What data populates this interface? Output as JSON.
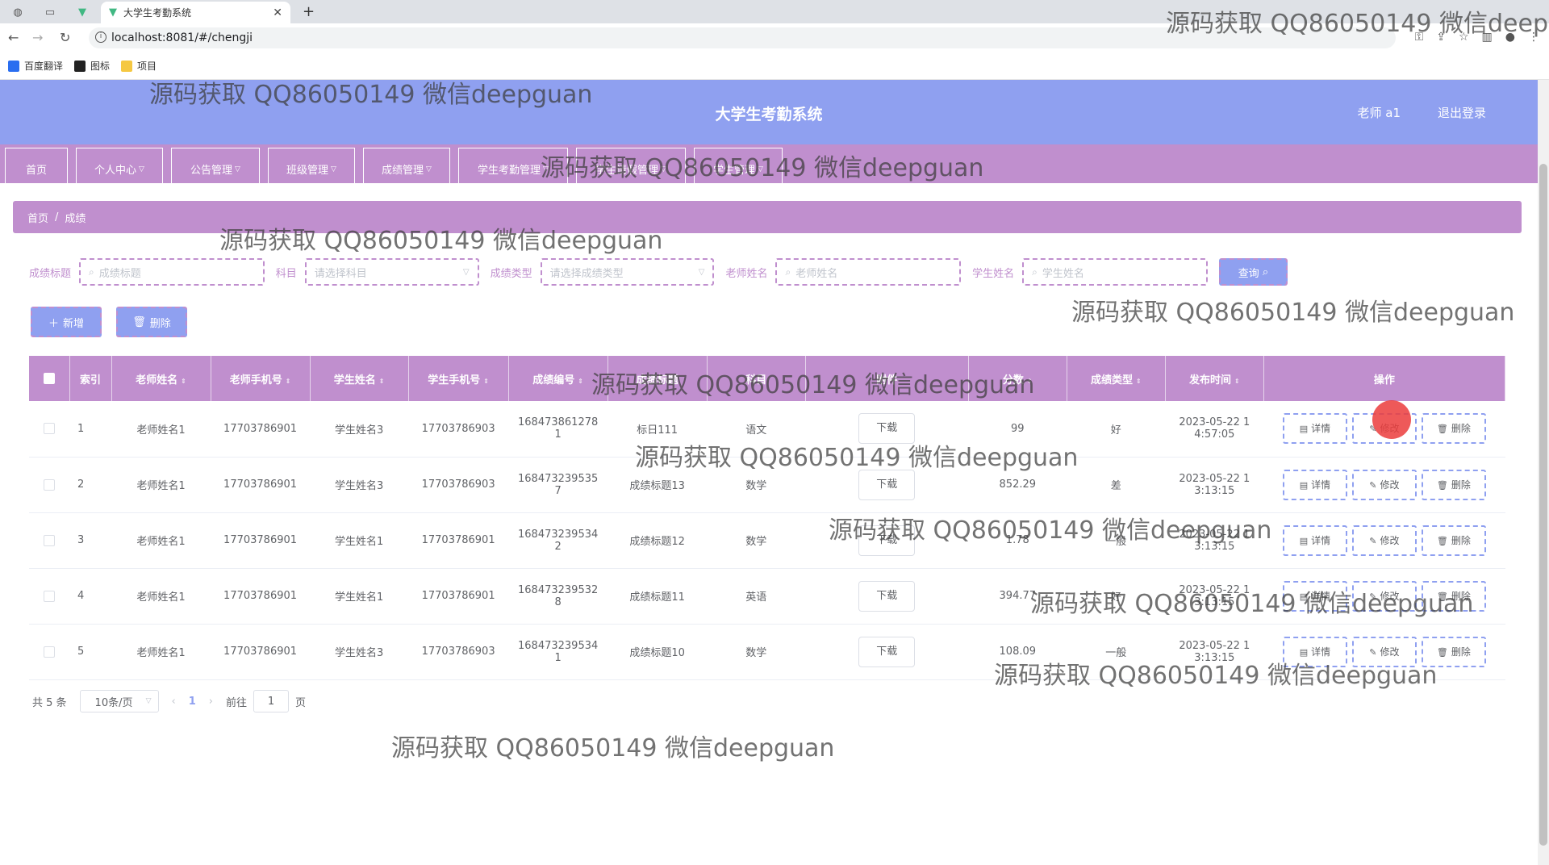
{
  "browser": {
    "tab_title": "大学生考勤系统",
    "url": "localhost:8081/#/chengji",
    "bookmarks": [
      "百度翻译",
      "图标",
      "项目"
    ]
  },
  "header": {
    "title": "大学生考勤系统",
    "user": "老师 a1",
    "logout": "退出登录"
  },
  "menu": [
    "首页",
    "个人中心",
    "公告管理",
    "班级管理",
    "成绩管理",
    "学生考勤管理",
    "学生请假管理",
    "学生管理"
  ],
  "breadcrumb": [
    "首页",
    "/",
    "成绩"
  ],
  "search": {
    "title_label": "成绩标题",
    "title_placeholder": "成绩标题",
    "subject_label": "科目",
    "subject_placeholder": "请选择科目",
    "type_label": "成绩类型",
    "type_placeholder": "请选择成绩类型",
    "teacher_label": "老师姓名",
    "teacher_placeholder": "老师姓名",
    "student_label": "学生姓名",
    "student_placeholder": "学生姓名",
    "query_button": "查询"
  },
  "actions": {
    "add": "新增",
    "delete": "删除"
  },
  "table": {
    "headers": [
      "索引",
      "老师姓名",
      "老师手机号",
      "学生姓名",
      "学生手机号",
      "成绩编号",
      "成绩标题",
      "科目",
      "附件",
      "分数",
      "成绩类型",
      "发布时间",
      "操作"
    ],
    "download_label": "下载",
    "op_detail": "详情",
    "op_edit": "修改",
    "op_delete": "删除",
    "rows": [
      {
        "index": "1",
        "teacher": "老师姓名1",
        "teacher_phone": "17703786901",
        "student": "学生姓名3",
        "student_phone": "17703786903",
        "code_a": "168473861278",
        "code_b": "1",
        "title": "标日111",
        "subject": "语文",
        "score": "99",
        "type": "好",
        "time_a": "2023-05-22 1",
        "time_b": "4:57:05"
      },
      {
        "index": "2",
        "teacher": "老师姓名1",
        "teacher_phone": "17703786901",
        "student": "学生姓名3",
        "student_phone": "17703786903",
        "code_a": "168473239535",
        "code_b": "7",
        "title": "成绩标题13",
        "subject": "数学",
        "score": "852.29",
        "type": "差",
        "time_a": "2023-05-22 1",
        "time_b": "3:13:15"
      },
      {
        "index": "3",
        "teacher": "老师姓名1",
        "teacher_phone": "17703786901",
        "student": "学生姓名1",
        "student_phone": "17703786901",
        "code_a": "168473239534",
        "code_b": "2",
        "title": "成绩标题12",
        "subject": "数学",
        "score": "1.78",
        "type": "一般",
        "time_a": "2023-05-22 1",
        "time_b": "3:13:15"
      },
      {
        "index": "4",
        "teacher": "老师姓名1",
        "teacher_phone": "17703786901",
        "student": "学生姓名1",
        "student_phone": "17703786901",
        "code_a": "168473239532",
        "code_b": "8",
        "title": "成绩标题11",
        "subject": "英语",
        "score": "394.77",
        "type": "好",
        "time_a": "2023-05-22 1",
        "time_b": "3:13:15"
      },
      {
        "index": "5",
        "teacher": "老师姓名1",
        "teacher_phone": "17703786901",
        "student": "学生姓名3",
        "student_phone": "17703786903",
        "code_a": "168473239534",
        "code_b": "1",
        "title": "成绩标题10",
        "subject": "数学",
        "score": "108.09",
        "type": "一般",
        "time_a": "2023-05-22 1",
        "time_b": "3:13:15"
      }
    ]
  },
  "pagination": {
    "total": "共 5 条",
    "page_size": "10条/页",
    "current": "1",
    "goto_prefix": "前往",
    "goto_value": "1",
    "goto_suffix": "页"
  },
  "watermark": "源码获取 QQ86050149 微信deepguan",
  "colors": {
    "header": "#8fa0f0",
    "menu": "#c08fce",
    "accent": "#c08fce"
  }
}
